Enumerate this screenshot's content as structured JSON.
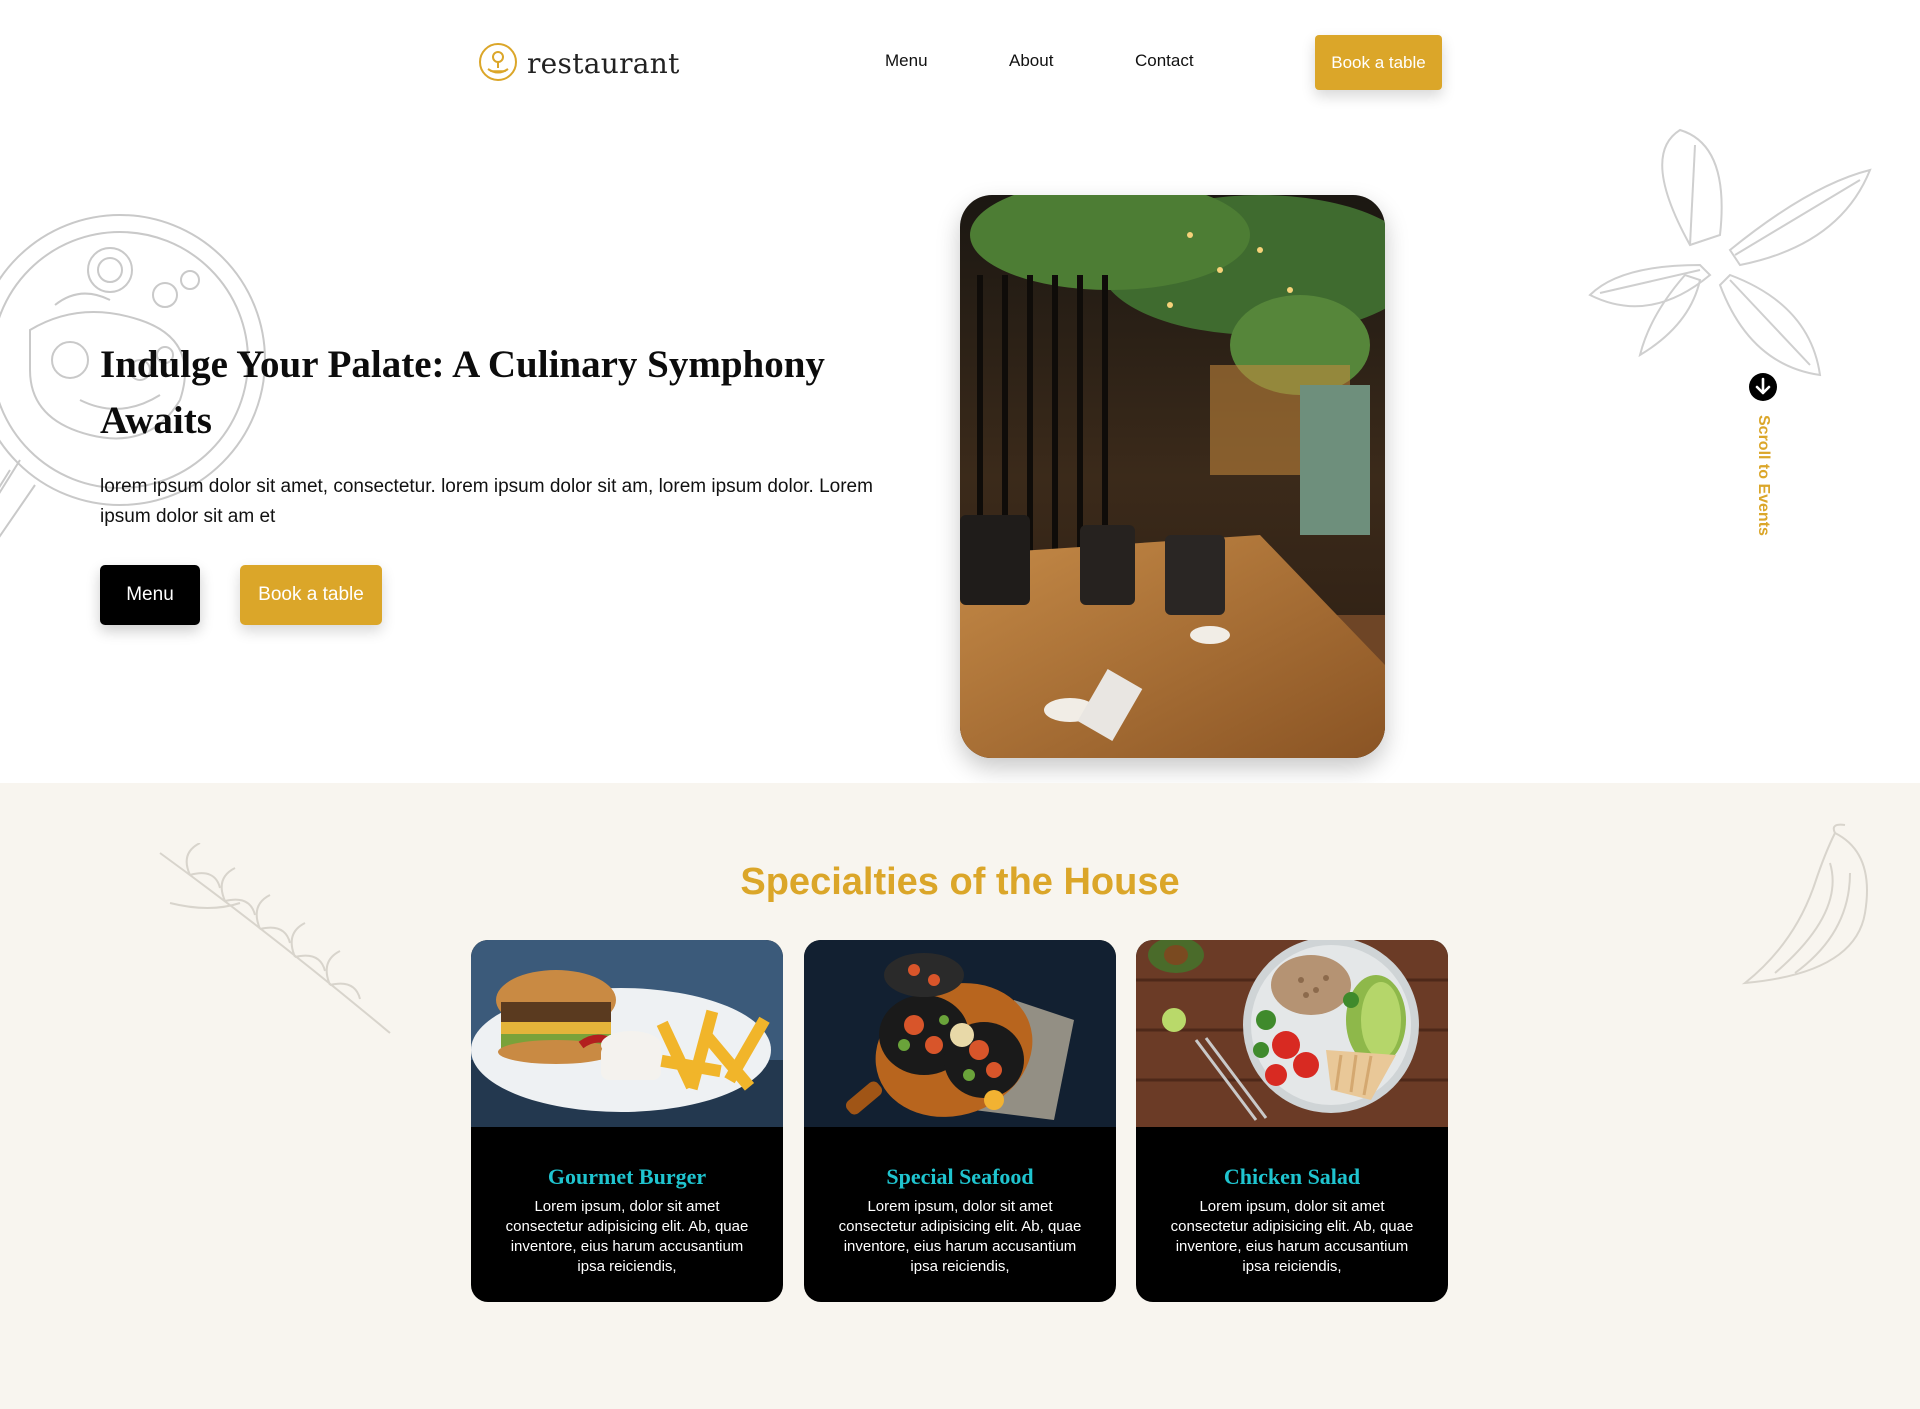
{
  "colors": {
    "accent": "#dba629",
    "dark": "#000000",
    "teal": "#1fc4cf",
    "section_bg": "#f8f5ef"
  },
  "header": {
    "logo_text": "restaurant",
    "nav": [
      "Menu",
      "About",
      "Contact"
    ],
    "book_label": "Book a table"
  },
  "hero": {
    "title": "Indulge Your Palate: A Culinary Symphony Awaits",
    "text": "lorem ipsum dolor sit amet, consectetur. lorem ipsum dolor sit am, lorem ipsum dolor. Lorem ipsum dolor sit am et",
    "menu_label": "Menu",
    "book_label": "Book a table",
    "scroll_label": "Scroll to Events"
  },
  "specials": {
    "title": "Specialties of the House",
    "cards": [
      {
        "title": "Gourmet Burger",
        "text": "Lorem ipsum, dolor sit amet consectetur adipisicing elit. Ab, quae inventore, eius harum accusantium ipsa reiciendis,"
      },
      {
        "title": "Special Seafood",
        "text": "Lorem ipsum, dolor sit amet consectetur adipisicing elit. Ab, quae inventore, eius harum accusantium ipsa reiciendis,"
      },
      {
        "title": "Chicken Salad",
        "text": "Lorem ipsum, dolor sit amet consectetur adipisicing elit. Ab, quae inventore, eius harum accusantium ipsa reiciendis,"
      }
    ]
  }
}
